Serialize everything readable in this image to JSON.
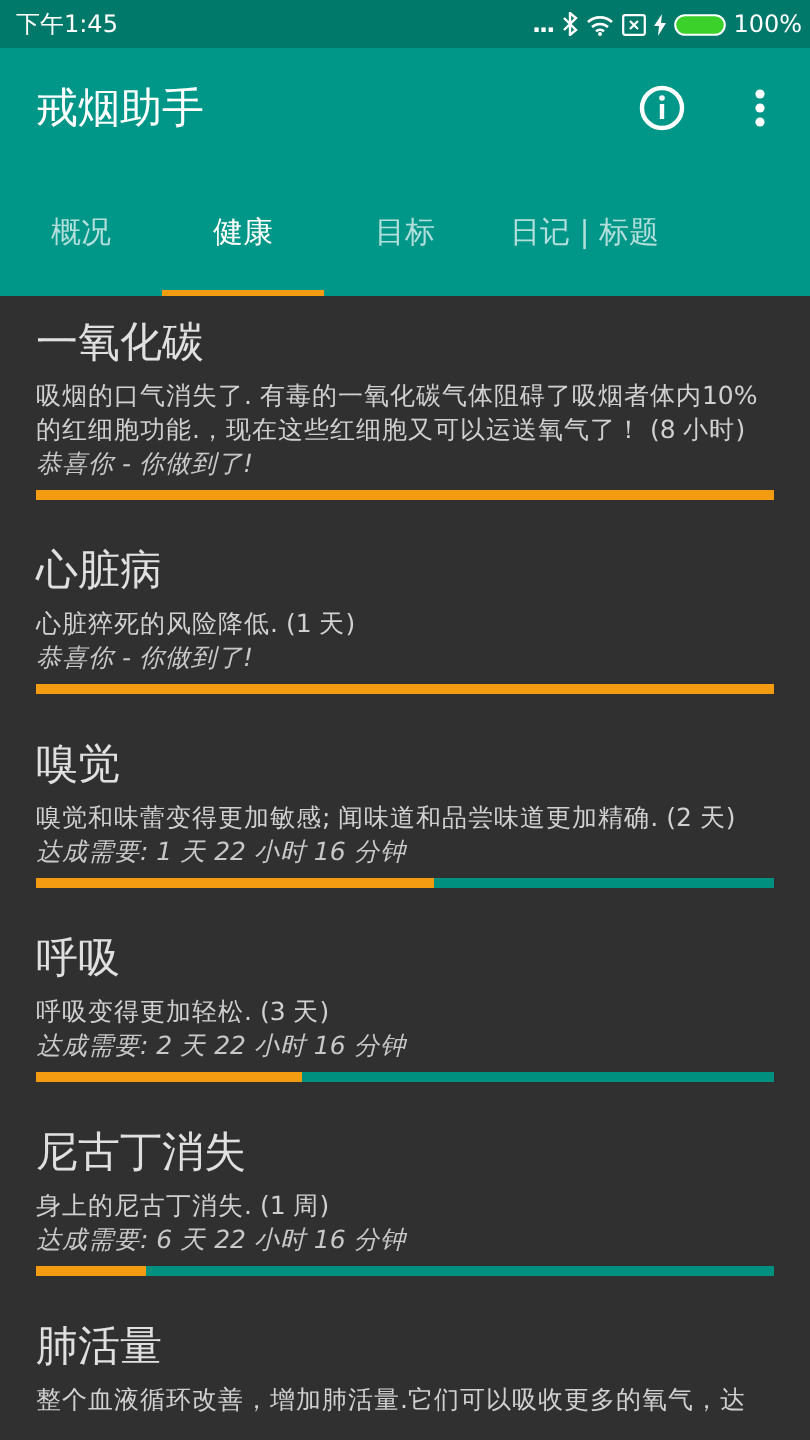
{
  "status_bar": {
    "time": "下午1:45",
    "dots": "...",
    "battery": "100%"
  },
  "app_bar": {
    "title": "戒烟助手"
  },
  "tabs": [
    {
      "label": "概况",
      "selected": false
    },
    {
      "label": "健康",
      "selected": true
    },
    {
      "label": "目标",
      "selected": false
    },
    {
      "label": "日记 | 标题",
      "selected": false
    }
  ],
  "milestones": [
    {
      "title": "一氧化碳",
      "description": "吸烟的口气消失了. 有毒的一氧化碳气体阻碍了吸烟者体内10%的红细胞功能.，现在这些红细胞又可以运送氧气了！ (8 小时)",
      "status": "恭喜你 - 你做到了!",
      "level": 1
    },
    {
      "title": "心脏病",
      "description": "心脏猝死的风险降低. (1 天)",
      "status": "恭喜你 - 你做到了!",
      "level": 1
    },
    {
      "title": "嗅觉",
      "description": "嗅觉和味蕾变得更加敏感; 闻味道和品尝味道更加精确. (2 天)",
      "status": "达成需要: 1 天 22 小时 16 分钟",
      "level": 0.54
    },
    {
      "title": "呼吸",
      "description": "呼吸变得更加轻松. (3 天)",
      "status": "达成需要: 2 天 22 小时 16 分钟",
      "level": 0.36
    },
    {
      "title": "尼古丁消失",
      "description": "身上的尼古丁消失. (1 周)",
      "status": "达成需要: 6 天 22 小时 16 分钟",
      "level": 0.15
    },
    {
      "title": "肺活量",
      "description": "整个血液循环改善，增加肺活量.它们可以吸收更多的氧气，达"
    }
  ]
}
